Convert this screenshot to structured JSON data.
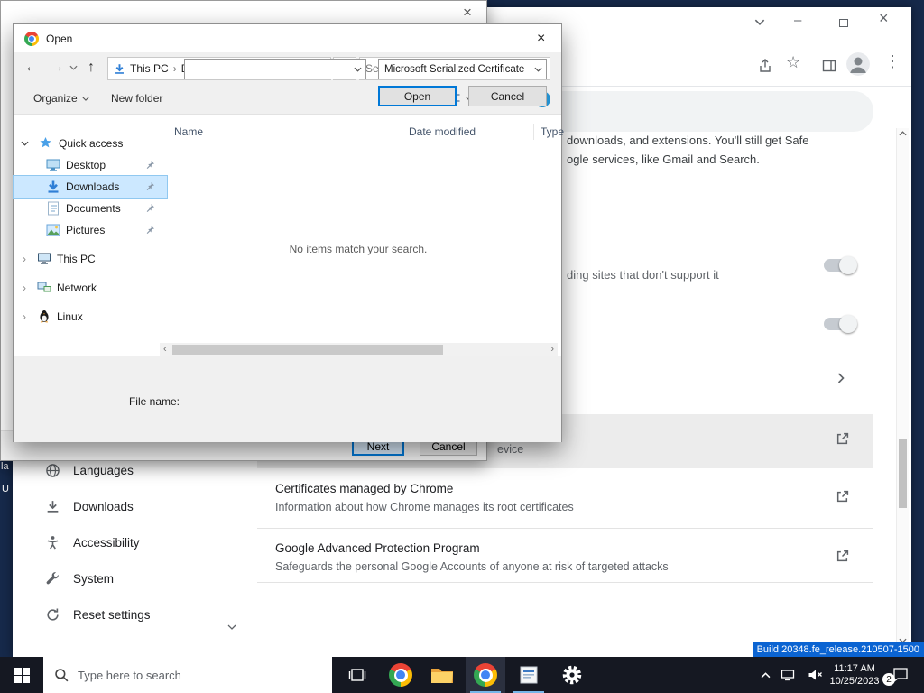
{
  "colors": {
    "accent": "#0078d7",
    "selection": "#cce8ff",
    "taskbar": "#151822",
    "watermark_bg": "#0b64d2",
    "hover_row": "#ececec"
  },
  "desktop": {
    "edge_fragments": [
      "la",
      "U"
    ],
    "watermark": "Build 20348.fe_release.210507-1500"
  },
  "wizard": {
    "next_label": "Next",
    "cancel_label": "Cancel"
  },
  "open_dialog": {
    "title": "Open",
    "nav": {
      "breadcrumb_root": "This PC",
      "breadcrumb_current": "Downloads",
      "search_placeholder": "Search Downloads"
    },
    "toolbar": {
      "organize_label": "Organize",
      "new_folder_label": "New folder"
    },
    "sidebar": {
      "quick_access_label": "Quick access",
      "pinned": [
        {
          "label": "Desktop"
        },
        {
          "label": "Downloads"
        },
        {
          "label": "Documents"
        },
        {
          "label": "Pictures"
        }
      ],
      "tree": [
        {
          "label": "This PC"
        },
        {
          "label": "Network"
        },
        {
          "label": "Linux"
        }
      ]
    },
    "list": {
      "columns": [
        "Name",
        "Date modified",
        "Type"
      ],
      "empty_message": "No items match your search."
    },
    "footer": {
      "file_name_label": "File name:",
      "file_name_value": "",
      "file_type_value": "Microsoft Serialized Certificate",
      "open_label": "Open",
      "cancel_label": "Cancel"
    }
  },
  "browser": {
    "settings_fragments": {
      "safe_browsing_line1": "downloads, and extensions. You'll still get Safe",
      "safe_browsing_line2": "ogle services, like Gmail and Search.",
      "secure_connections": "ding sites that don't support it",
      "device_certificates": "evice"
    },
    "rows": [
      {
        "title": "Certificates managed by Chrome",
        "subtitle": "Information about how Chrome manages its root certificates"
      },
      {
        "title": "Google Advanced Protection Program",
        "subtitle": "Safeguards the personal Google Accounts of anyone at risk of targeted attacks"
      }
    ],
    "menu": [
      {
        "label": "Languages"
      },
      {
        "label": "Downloads"
      },
      {
        "label": "Accessibility"
      },
      {
        "label": "System"
      },
      {
        "label": "Reset settings"
      }
    ]
  },
  "taskbar": {
    "search_placeholder": "Type here to search",
    "clock_time": "11:17 AM",
    "clock_date": "10/25/2023",
    "notification_badge": "2"
  },
  "glyphs": {
    "back": "←",
    "forward": "→",
    "up": "↑",
    "refresh": "↻",
    "chevron_right": "›",
    "chevron_left": "‹",
    "menu_kebab": "⋮",
    "star": "☆",
    "minimize": "–",
    "close": "×",
    "question": "?"
  }
}
